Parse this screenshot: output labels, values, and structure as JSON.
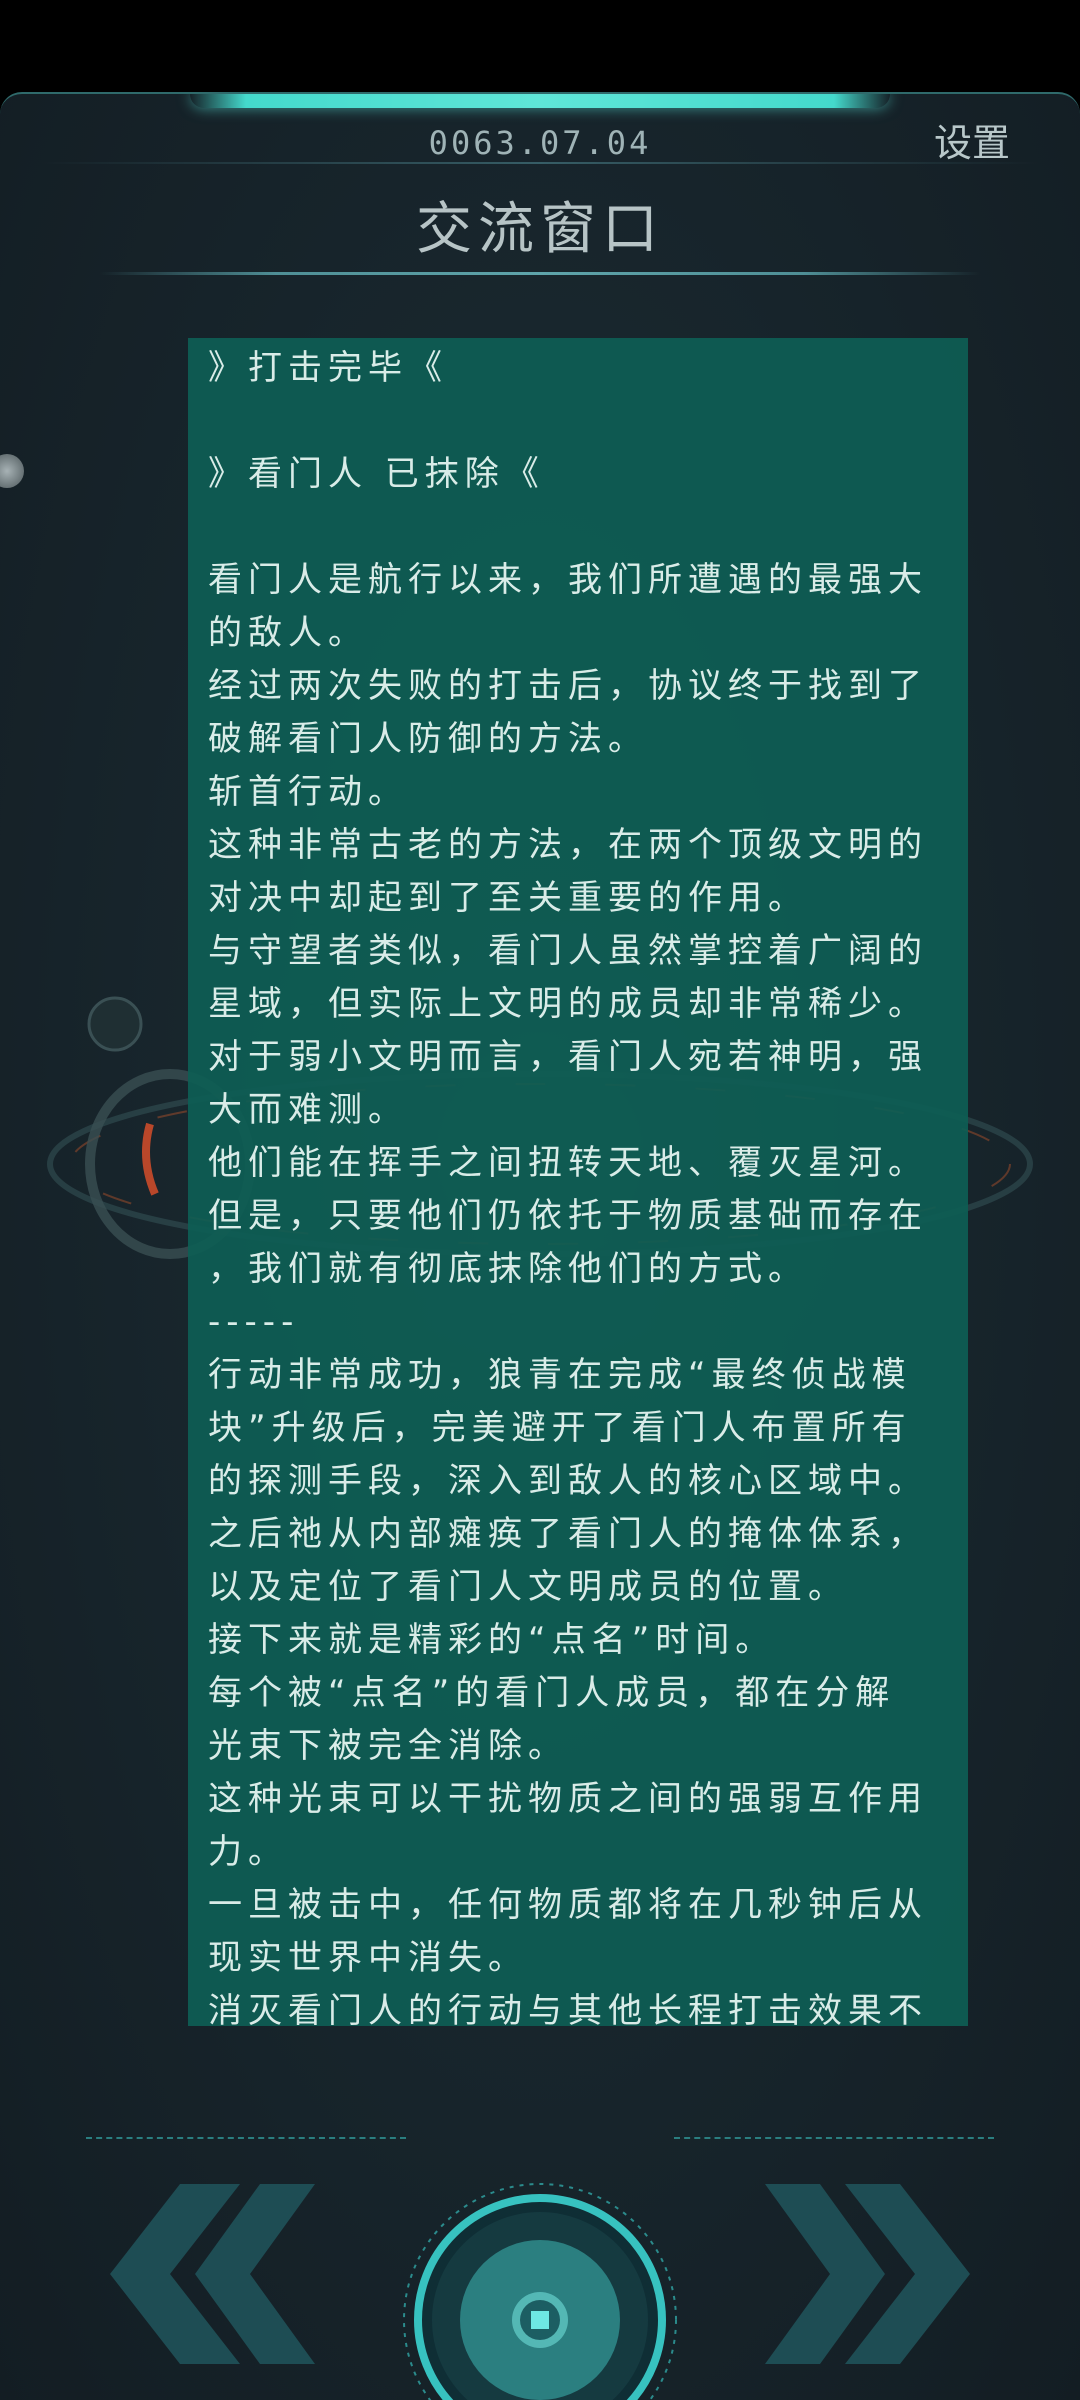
{
  "header": {
    "date": "0063.07.04",
    "settings_label": "设置",
    "title": "交流窗口"
  },
  "message": {
    "lines": [
      "》打击完毕《",
      "",
      "》看门人 已抹除《",
      "",
      "看门人是航行以来，我们所遭遇的最强大",
      "的敌人。",
      "经过两次失败的打击后，协议终于找到了",
      "破解看门人防御的方法。",
      "斩首行动。",
      "这种非常古老的方法，在两个顶级文明的",
      "对决中却起到了至关重要的作用。",
      "与守望者类似，看门人虽然掌控着广阔的",
      "星域，但实际上文明的成员却非常稀少。",
      "对于弱小文明而言，看门人宛若神明，强",
      "大而难测。",
      "他们能在挥手之间扭转天地、覆灭星河。",
      "但是，只要他们仍依托于物质基础而存在",
      "，我们就有彻底抹除他们的方式。",
      "-----",
      "行动非常成功，狼青在完成“最终侦战模",
      "块”升级后，完美避开了看门人布置所有",
      "的探测手段，深入到敌人的核心区域中。",
      "之后祂从内部瘫痪了看门人的掩体体系，",
      "以及定位了看门人文明成员的位置。",
      "接下来就是精彩的“点名”时间。",
      "每个被“点名”的看门人成员，都在分解",
      "光束下被完全消除。",
      "这种光束可以干扰物质之间的强弱互作用",
      "力。",
      "一旦被击中，任何物质都将在几秒钟后从",
      "现实世界中消失。",
      "消灭看门人的行动与其他长程打击效果不"
    ]
  },
  "controls": {
    "prev_icon": "double-chevron-left-icon",
    "next_icon": "double-chevron-right-icon",
    "center_icon": "circle-confirm-icon"
  },
  "colors": {
    "panel_bg": "#0e5e54",
    "accent": "#44d9cc",
    "chevron": "#1f4e55"
  }
}
